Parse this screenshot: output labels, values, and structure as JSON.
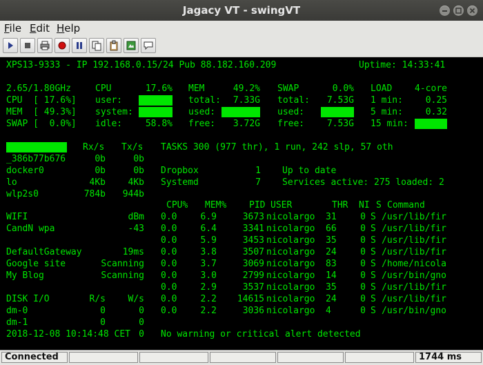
{
  "window": {
    "title": "Jagacy VT - swingVT"
  },
  "menu": [
    {
      "key": "F",
      "rest": "ile"
    },
    {
      "key": "E",
      "rest": "dit"
    },
    {
      "key": "H",
      "rest": "elp"
    }
  ],
  "toolbar": [
    "play-icon",
    "stop-icon",
    "print-icon",
    "record-icon",
    "pause-icon",
    "copy-icon",
    "paste-icon",
    "image-icon",
    "speech-bubble-icon"
  ],
  "terminal": {
    "host": "XPS13-9333 - IP 192.168.0.15/24 Pub 88.182.160.209",
    "uptime": "Uptime: 14:33:41",
    "cpu_summary": {
      "freq": "2.65/1.80GHz",
      "cpu_label": "CPU",
      "cpu_pct": "17.6%",
      "mem_label": "MEM",
      "mem_pct": "49.2%",
      "swap_label": "SWAP",
      "swap_pct": "0.0%",
      "load_label": "LOAD",
      "load_cores": "4-core"
    },
    "rows": [
      {
        "left": "CPU  [ 17.6%]",
        "a": "user:",
        "b": "total:",
        "bv": "7.33G",
        "c": "total:",
        "cv": "7.53G",
        "d": "1 min:",
        "dv": "0.25"
      },
      {
        "left": "MEM  [ 49.3%]",
        "a": "system:",
        "b": "used:",
        "c": "used:",
        "d": "5 min:",
        "dv": "0.32"
      },
      {
        "left": "SWAP [  0.0%]",
        "a": "idle:",
        "av": "58.8%",
        "b": "free:",
        "bv": "3.72G",
        "c": "free:",
        "cv": "7.53G",
        "d": "15 min:"
      }
    ],
    "net_header": {
      "rx": "Rx/s",
      "tx": "Tx/s"
    },
    "net": [
      {
        "name": "_386b77b676",
        "rx": "0b",
        "tx": "0b"
      },
      {
        "name": "docker0",
        "rx": "0b",
        "tx": "0b"
      },
      {
        "name": "lo",
        "rx": "4Kb",
        "tx": "4Kb"
      },
      {
        "name": "wlp2s0",
        "rx": "784b",
        "tx": "944b"
      }
    ],
    "tasks": "TASKS 300 (977 thr), 1 run, 242 slp, 57 oth",
    "services": [
      {
        "name": "Dropbox",
        "count": "1",
        "status": "Up to date"
      },
      {
        "name": "Systemd",
        "count": "7",
        "status": "Services active: 275 loaded: 2"
      }
    ],
    "proc_header": {
      "cpu": "CPU%",
      "mem": "MEM%",
      "pid": "PID",
      "user": "USER",
      "thr": "THR",
      "ni": "NI",
      "s": "S",
      "cmd": "Command"
    },
    "procs": [
      {
        "cpu": "0.0",
        "mem": "6.9",
        "pid": "3673",
        "user": "nicolargo",
        "thr": "31",
        "ni": "0",
        "s": "S",
        "cmd": "/usr/lib/fir"
      },
      {
        "cpu": "0.0",
        "mem": "6.4",
        "pid": "3341",
        "user": "nicolargo",
        "thr": "66",
        "ni": "0",
        "s": "S",
        "cmd": "/usr/lib/fir"
      },
      {
        "cpu": "0.0",
        "mem": "5.9",
        "pid": "3453",
        "user": "nicolargo",
        "thr": "35",
        "ni": "0",
        "s": "S",
        "cmd": "/usr/lib/fir"
      },
      {
        "cpu": "0.0",
        "mem": "3.8",
        "pid": "3507",
        "user": "nicolargo",
        "thr": "24",
        "ni": "0",
        "s": "S",
        "cmd": "/usr/lib/fir"
      },
      {
        "cpu": "0.0",
        "mem": "3.7",
        "pid": "3069",
        "user": "nicolargo",
        "thr": "83",
        "ni": "0",
        "s": "S",
        "cmd": "/home/nicola"
      },
      {
        "cpu": "0.0",
        "mem": "3.0",
        "pid": "2799",
        "user": "nicolargo",
        "thr": "14",
        "ni": "0",
        "s": "S",
        "cmd": "/usr/bin/gno"
      },
      {
        "cpu": "0.0",
        "mem": "2.9",
        "pid": "3537",
        "user": "nicolargo",
        "thr": "35",
        "ni": "0",
        "s": "S",
        "cmd": "/usr/lib/fir"
      },
      {
        "cpu": "0.0",
        "mem": "2.2",
        "pid": "14615",
        "user": "nicolargo",
        "thr": "24",
        "ni": "0",
        "s": "S",
        "cmd": "/usr/lib/fir"
      },
      {
        "cpu": "0.0",
        "mem": "2.2",
        "pid": "3036",
        "user": "nicolargo",
        "thr": "4",
        "ni": "0",
        "s": "S",
        "cmd": "/usr/bin/gno"
      }
    ],
    "wifi": {
      "label": "WIFI",
      "unit": "dBm",
      "ssid": "CandN wpa",
      "value": "-43"
    },
    "ports": [
      {
        "name": "DefaultGateway",
        "value": "19ms"
      },
      {
        "name": "Google site",
        "value": "Scanning"
      },
      {
        "name": "My Blog",
        "value": "Scanning"
      }
    ],
    "disk_header": {
      "label": "DISK I/O",
      "r": "R/s",
      "w": "W/s"
    },
    "disks": [
      {
        "name": "dm-0",
        "r": "0",
        "w": "0"
      },
      {
        "name": "dm-1",
        "r": "0",
        "w": "0"
      }
    ],
    "datetime": "2018-12-08 10:14:48 CET",
    "datetime_tail": "0",
    "alert": "No warning or critical alert detected"
  },
  "status": {
    "connection": "Connected",
    "latency": "1744 ms"
  },
  "colors": {
    "terminal_fg": "#00e600",
    "terminal_bg": "#000000"
  }
}
